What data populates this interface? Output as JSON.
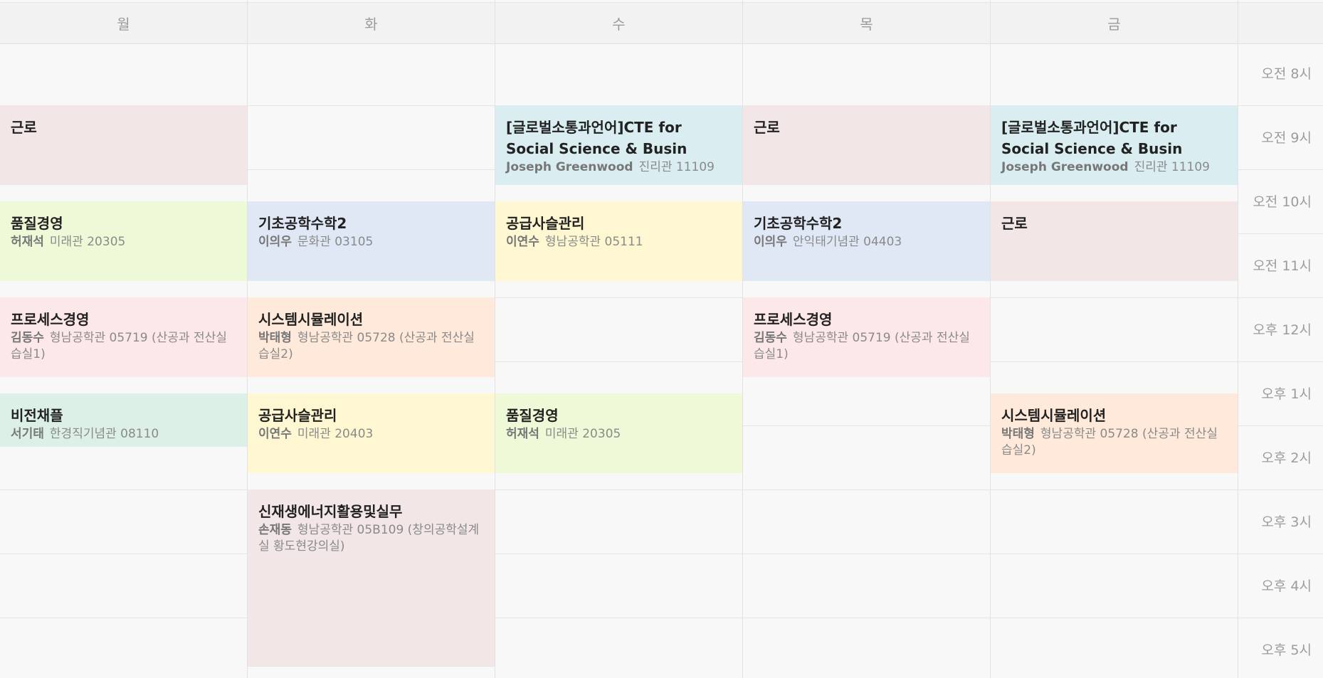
{
  "days": [
    "월",
    "화",
    "수",
    "목",
    "금"
  ],
  "hours": [
    "오전 8시",
    "오전 9시",
    "오전 10시",
    "오전 11시",
    "오후 12시",
    "오후 1시",
    "오후 2시",
    "오후 3시",
    "오후 4시",
    "오후 5시"
  ],
  "courses": [
    {
      "day": 0,
      "title": "근로",
      "professor": "",
      "room": "",
      "color": "#f2e6e6"
    },
    {
      "day": 0,
      "title": "품질경영",
      "professor": "허재석",
      "room": "미래관 20305",
      "color": "#eef9d7"
    },
    {
      "day": 0,
      "title": "프로세스경영",
      "professor": "김동수",
      "room": "형남공학관 05719 (산공과 전산실습실1)",
      "color": "#fde8e9"
    },
    {
      "day": 0,
      "title": "비전채플",
      "professor": "서기태",
      "room": "한경직기념관 08110",
      "color": "#dcf0e8"
    },
    {
      "day": 1,
      "title": "기초공학수학2",
      "professor": "이의우",
      "room": "문화관 03105",
      "color": "#e0e8f6"
    },
    {
      "day": 1,
      "title": "시스템시뮬레이션",
      "professor": "박태형",
      "room": "형남공학관 05728 (산공과 전산실습실2)",
      "color": "#fee9da"
    },
    {
      "day": 1,
      "title": "공급사슬관리",
      "professor": "이연수",
      "room": "미래관 20403",
      "color": "#fef7d1"
    },
    {
      "day": 1,
      "title": "신재생에너지활용및실무",
      "professor": "손재동",
      "room": "형남공학관 05B109 (창의공학설계실 황도현강의실)",
      "color": "#f2e6e6"
    },
    {
      "day": 2,
      "title": "[글로벌소통과언어]CTE for Social Science & Busin",
      "professor": "Joseph Greenwood",
      "room": "진리관 11109",
      "color": "#daeef2"
    },
    {
      "day": 2,
      "title": "공급사슬관리",
      "professor": "이연수",
      "room": "형남공학관 05111",
      "color": "#fef7d1"
    },
    {
      "day": 2,
      "title": "품질경영",
      "professor": "허재석",
      "room": "미래관 20305",
      "color": "#eef9d7"
    },
    {
      "day": 3,
      "title": "근로",
      "professor": "",
      "room": "",
      "color": "#f2e6e6"
    },
    {
      "day": 3,
      "title": "기초공학수학2",
      "professor": "이의우",
      "room": "안익태기념관 04403",
      "color": "#e0e8f6"
    },
    {
      "day": 3,
      "title": "프로세스경영",
      "professor": "김동수",
      "room": "형남공학관 05719 (산공과 전산실습실1)",
      "color": "#fde8e9"
    },
    {
      "day": 4,
      "title": "[글로벌소통과언어]CTE for Social Science & Busin",
      "professor": "Joseph Greenwood",
      "room": "진리관 11109",
      "color": "#daeef2"
    },
    {
      "day": 4,
      "title": "근로",
      "professor": "",
      "room": "",
      "color": "#f2e6e6"
    },
    {
      "day": 4,
      "title": "시스템시뮬레이션",
      "professor": "박태형",
      "room": "형남공학관 05728 (산공과 전산실습실2)",
      "color": "#fee9da"
    }
  ]
}
